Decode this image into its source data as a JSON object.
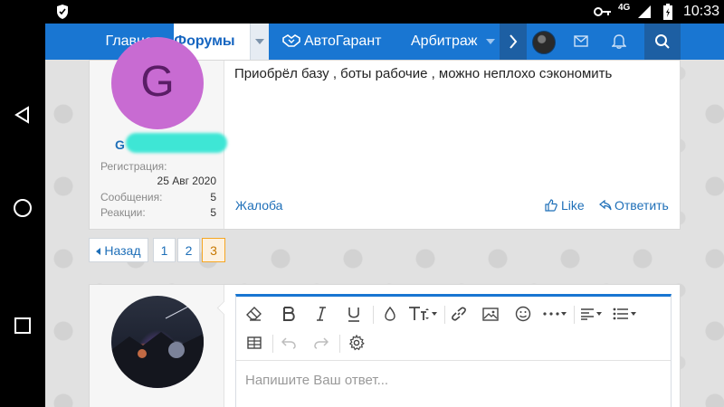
{
  "status": {
    "network": "4G",
    "time": "10:33"
  },
  "nav": {
    "tabs": [
      "Главная",
      "Форумы",
      "АвтоГарант",
      "Арбитраж"
    ]
  },
  "post": {
    "avatar_letter": "G",
    "username_fragment": "G",
    "stats": [
      {
        "label": "Регистрация:",
        "value": "25 Авг 2020"
      },
      {
        "label": "Сообщения:",
        "value": "5"
      },
      {
        "label": "Реакции:",
        "value": "5"
      }
    ],
    "text": "Приобрёл базу , боты рабочие , можно неплохо сэкономить",
    "report_label": "Жалоба",
    "like_label": "Like",
    "reply_label": "Ответить"
  },
  "pagination": {
    "prev_label": "Назад",
    "pages": [
      "1",
      "2",
      "3"
    ],
    "current": "3"
  },
  "editor": {
    "placeholder": "Напишите Ваш ответ..."
  },
  "colors": {
    "nav": "#1976d2",
    "link": "#1e6fb8",
    "avatar": "#c86bd2",
    "accent": "#f5a623"
  }
}
